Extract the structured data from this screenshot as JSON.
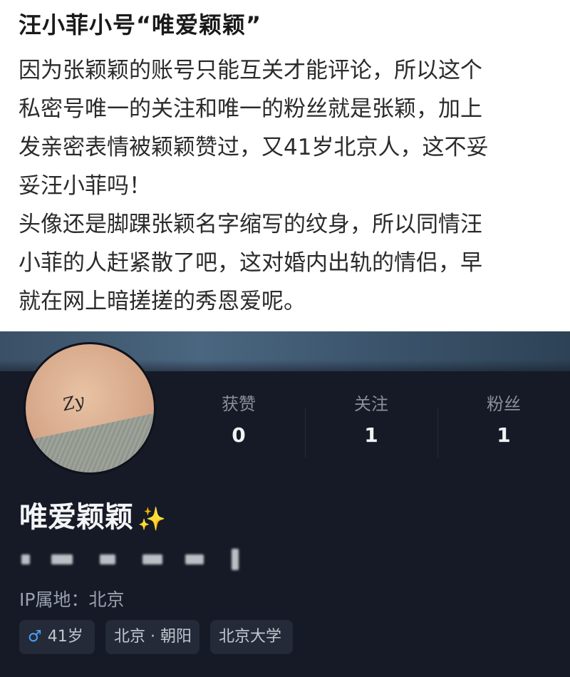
{
  "post": {
    "title": "汪小菲小号“唯爱颖颖”",
    "paragraphs": [
      "因为张颖颖的账号只能互关才能评论，所以这个",
      "私密号唯一的关注和唯一的粉丝就是张颖，加上",
      "发亲密表情被颖颖赞过，又41岁北京人，这不妥",
      "妥汪小菲吗！",
      "头像还是脚踝张颖名字缩写的纹身，所以同情汪",
      "小菲的人赶紧散了吧，这对婚内出轨的情侣，早",
      "就在网上暗搓搓的秀恩爱呢。"
    ]
  },
  "profile": {
    "avatar_tattoo_text": "Zy",
    "stats": [
      {
        "label": "获赞",
        "value": "0"
      },
      {
        "label": "关注",
        "value": "1"
      },
      {
        "label": "粉丝",
        "value": "1"
      }
    ],
    "nickname": "唯爱颖颖",
    "nickname_emoji": "sparkles-icon",
    "ip_location": "IP属地：北京",
    "tags": {
      "gender_icon": "male-icon",
      "age": "41岁",
      "location": "北京 · 朝阳",
      "school": "北京大学"
    },
    "colors": {
      "background": "#151a26",
      "male_accent": "#4aa3ff",
      "sparkle": "#f0c94a"
    }
  }
}
